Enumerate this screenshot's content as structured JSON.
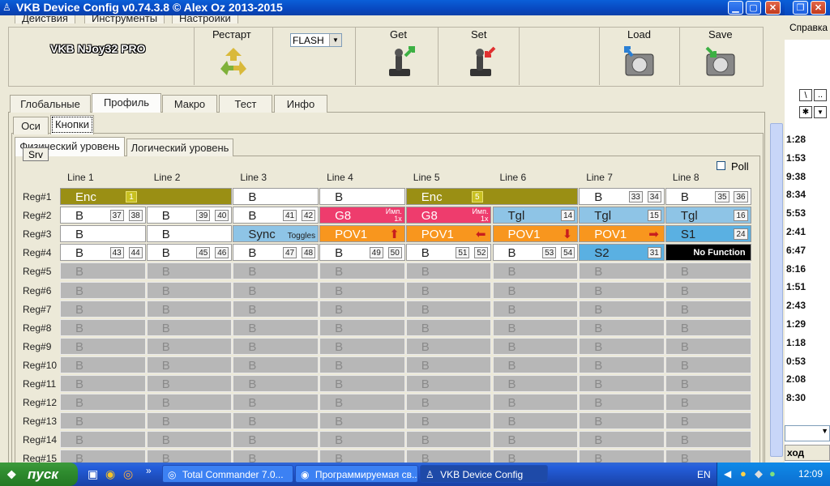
{
  "window": {
    "title": "VKB Device Config v0.74.3.8 © Alex Oz 2013-2015"
  },
  "top_tabs": [
    "Действия",
    "Инструменты",
    "Настройки"
  ],
  "device_name": "VKB NJoy32 PRO",
  "toolbar": {
    "restart_label": "Рестарт",
    "mode_value": "FLASH",
    "get_label": "Get",
    "set_label": "Set",
    "load_label": "Load",
    "save_label": "Save"
  },
  "main_tabs": [
    "Глобальные",
    "Профиль",
    "Макро",
    "Тест",
    "Инфо"
  ],
  "sub_tabs": [
    "Оси",
    "Кнопки"
  ],
  "level_tabs": [
    "Физический уровень",
    "Логический уровень"
  ],
  "srv_label": "Srv",
  "poll_label": "Poll",
  "lines": [
    "Line 1",
    "Line 2",
    "Line 3",
    "Line 4",
    "Line 5",
    "Line 6",
    "Line 7",
    "Line 8"
  ],
  "regs": [
    "Reg#1",
    "Reg#2",
    "Reg#3",
    "Reg#4",
    "Reg#5",
    "Reg#6",
    "Reg#7",
    "Reg#8",
    "Reg#9",
    "Reg#10",
    "Reg#11",
    "Reg#12",
    "Reg#13",
    "Reg#14",
    "Reg#15"
  ],
  "grey_cell_text": "B",
  "grid": [
    [
      {
        "col": 0,
        "span": 2,
        "style": "olive",
        "text": "Enc",
        "nums": [
          "1"
        ]
      },
      {
        "col": 2,
        "span": 1,
        "style": "white",
        "text": "B",
        "nums": []
      },
      {
        "col": 3,
        "span": 1,
        "style": "white",
        "text": "B",
        "nums": []
      },
      {
        "col": 4,
        "span": 2,
        "style": "olive",
        "text": "Enc",
        "nums": [
          "5"
        ]
      },
      {
        "col": 6,
        "span": 1,
        "style": "white",
        "text": "B",
        "nums": [
          "33",
          "34"
        ]
      },
      {
        "col": 7,
        "span": 1,
        "style": "white",
        "text": "B",
        "nums": [
          "35",
          "36"
        ]
      }
    ],
    [
      {
        "col": 0,
        "span": 1,
        "style": "white",
        "text": "B",
        "nums": [
          "37",
          "38"
        ]
      },
      {
        "col": 1,
        "span": 1,
        "style": "white",
        "text": "B",
        "nums": [
          "39",
          "40"
        ]
      },
      {
        "col": 2,
        "span": 1,
        "style": "white",
        "text": "B",
        "nums": [
          "41",
          "42"
        ]
      },
      {
        "col": 3,
        "span": 1,
        "style": "pink",
        "text": "G8",
        "sub": [
          "Имп.",
          "1x"
        ],
        "nums": []
      },
      {
        "col": 4,
        "span": 1,
        "style": "pink",
        "text": "G8",
        "sub": [
          "Имп.",
          "1x"
        ],
        "nums": []
      },
      {
        "col": 5,
        "span": 1,
        "style": "blue",
        "text": "Tgl",
        "nums": [
          "14"
        ]
      },
      {
        "col": 6,
        "span": 1,
        "style": "blue",
        "text": "Tgl",
        "nums": [
          "15"
        ]
      },
      {
        "col": 7,
        "span": 1,
        "style": "blue",
        "text": "Tgl",
        "nums": [
          "16"
        ]
      }
    ],
    [
      {
        "col": 0,
        "span": 1,
        "style": "white",
        "text": "B",
        "nums": []
      },
      {
        "col": 1,
        "span": 1,
        "style": "white",
        "text": "B",
        "nums": []
      },
      {
        "col": 2,
        "span": 1,
        "style": "blue",
        "text": "Sync",
        "tag": "Toggles",
        "nums": []
      },
      {
        "col": 3,
        "span": 1,
        "style": "orange",
        "text": "POV1",
        "arrow": "up",
        "nums": []
      },
      {
        "col": 4,
        "span": 1,
        "style": "orange",
        "text": "POV1",
        "arrow": "left",
        "nums": []
      },
      {
        "col": 5,
        "span": 1,
        "style": "orange",
        "text": "POV1",
        "arrow": "down",
        "nums": []
      },
      {
        "col": 6,
        "span": 1,
        "style": "orange",
        "text": "POV1",
        "arrow": "right",
        "nums": []
      },
      {
        "col": 7,
        "span": 1,
        "style": "blue2",
        "text": "S1",
        "nums": [
          "24"
        ]
      }
    ],
    [
      {
        "col": 0,
        "span": 1,
        "style": "white",
        "text": "B",
        "nums": [
          "43",
          "44"
        ]
      },
      {
        "col": 1,
        "span": 1,
        "style": "white",
        "text": "B",
        "nums": [
          "45",
          "46"
        ]
      },
      {
        "col": 2,
        "span": 1,
        "style": "white",
        "text": "B",
        "nums": [
          "47",
          "48"
        ]
      },
      {
        "col": 3,
        "span": 1,
        "style": "white",
        "text": "B",
        "nums": [
          "49",
          "50"
        ]
      },
      {
        "col": 4,
        "span": 1,
        "style": "white",
        "text": "B",
        "nums": [
          "51",
          "52"
        ]
      },
      {
        "col": 5,
        "span": 1,
        "style": "white",
        "text": "B",
        "nums": [
          "53",
          "54"
        ]
      },
      {
        "col": 6,
        "span": 1,
        "style": "blue2",
        "text": "S2",
        "nums": [
          "31"
        ]
      },
      {
        "col": 7,
        "span": 1,
        "style": "black",
        "text": "No Function",
        "nums": []
      }
    ]
  ],
  "background_window": {
    "menu": "Справка",
    "times": [
      "1:28",
      "1:53",
      "9:38",
      "8:34",
      "5:53",
      "2:41",
      "6:47",
      "8:16",
      "1:51",
      "2:43",
      "1:29",
      "1:18",
      "0:53",
      "2:08",
      "8:30"
    ],
    "bottom_label": "ход"
  },
  "taskbar": {
    "start_label": "пуск",
    "items": [
      "Total Commander 7.0...",
      "Программируемая св...",
      "VKB Device Config"
    ],
    "lang": "EN",
    "clock": "12:09"
  },
  "colors": {
    "olive": "#9a8f14",
    "pink": "#ee3c6d",
    "blue": "#8ec4e6",
    "orange": "#f8961e",
    "grey": "#b7b7b7"
  }
}
